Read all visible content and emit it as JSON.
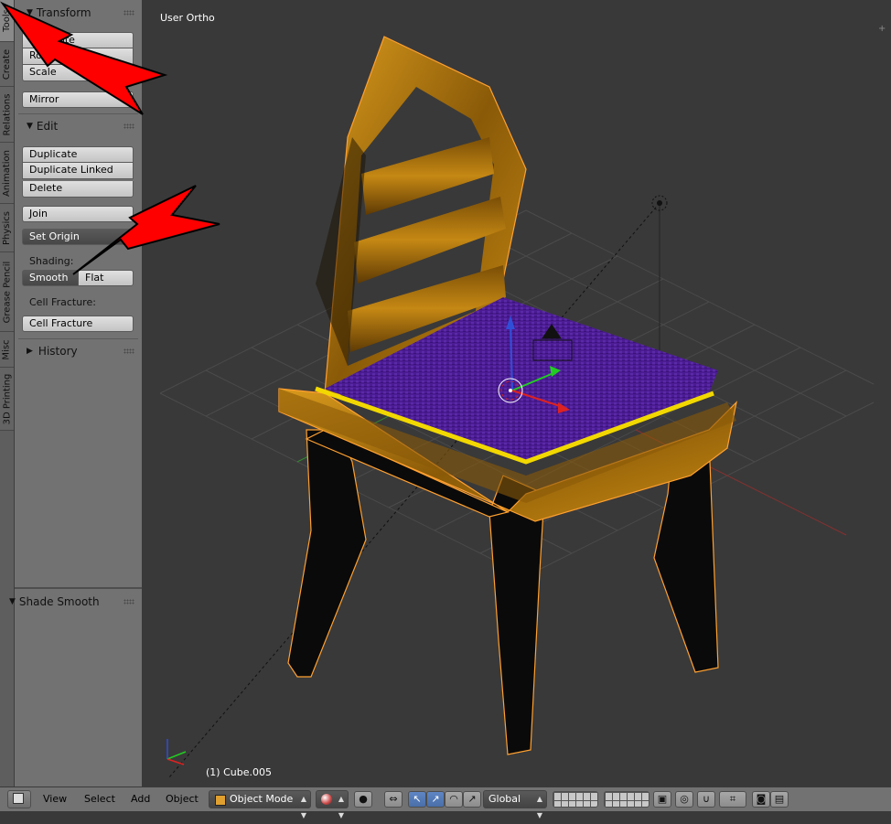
{
  "tabs": [
    "Tools",
    "Create",
    "Relations",
    "Animation",
    "Physics",
    "Grease Pencil",
    "Misc",
    "3D Printing"
  ],
  "transform": {
    "title": "Transform",
    "buttons": [
      "Translate",
      "Rotate",
      "Scale"
    ],
    "mirror": "Mirror"
  },
  "edit": {
    "title": "Edit",
    "buttons": [
      "Duplicate",
      "Duplicate Linked",
      "Delete"
    ],
    "join": "Join",
    "set_origin": "Set Origin",
    "shading_label": "Shading:",
    "smooth": "Smooth",
    "flat": "Flat",
    "cell_fracture_label": "Cell Fracture:",
    "cell_fracture": "Cell Fracture"
  },
  "history": {
    "title": "History"
  },
  "operator": {
    "title": "Shade Smooth"
  },
  "viewport": {
    "view_name": "User Ortho",
    "object_info": "(1) Cube.005"
  },
  "header": {
    "menus": [
      "View",
      "Select",
      "Add",
      "Object"
    ],
    "mode": "Object Mode",
    "orientation": "Global"
  },
  "colors": {
    "seat": "#4a1f8c",
    "wood": "#b57a10",
    "trim": "#e8d000",
    "selection_outline": "#ffa030"
  }
}
